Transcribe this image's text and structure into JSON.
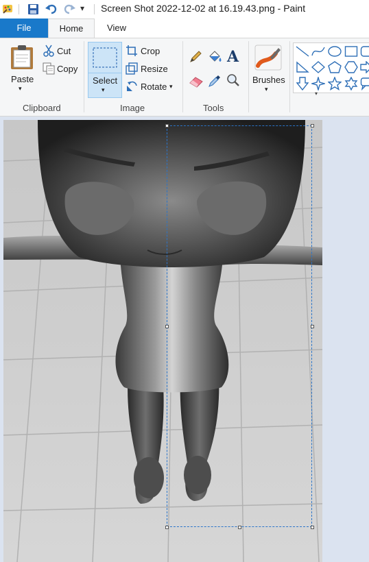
{
  "window": {
    "title": "Screen Shot 2022-12-02 at 16.19.43.png - Paint"
  },
  "quick_access": {
    "dropdown_glyph": "▾"
  },
  "tabs": [
    {
      "label": "File"
    },
    {
      "label": "Home"
    },
    {
      "label": "View"
    }
  ],
  "ribbon": {
    "clipboard": {
      "group": "Clipboard",
      "paste": "Paste",
      "cut": "Cut",
      "copy": "Copy"
    },
    "image": {
      "group": "Image",
      "select": "Select",
      "crop": "Crop",
      "resize": "Resize",
      "rotate": "Rotate"
    },
    "tools": {
      "group": "Tools",
      "text_glyph": "A"
    },
    "brushes": {
      "label": "Brushes"
    }
  },
  "colors": {
    "accent": "#1979ca",
    "selection": "#2a74c9",
    "shape_blue": "#2e6fb7"
  }
}
